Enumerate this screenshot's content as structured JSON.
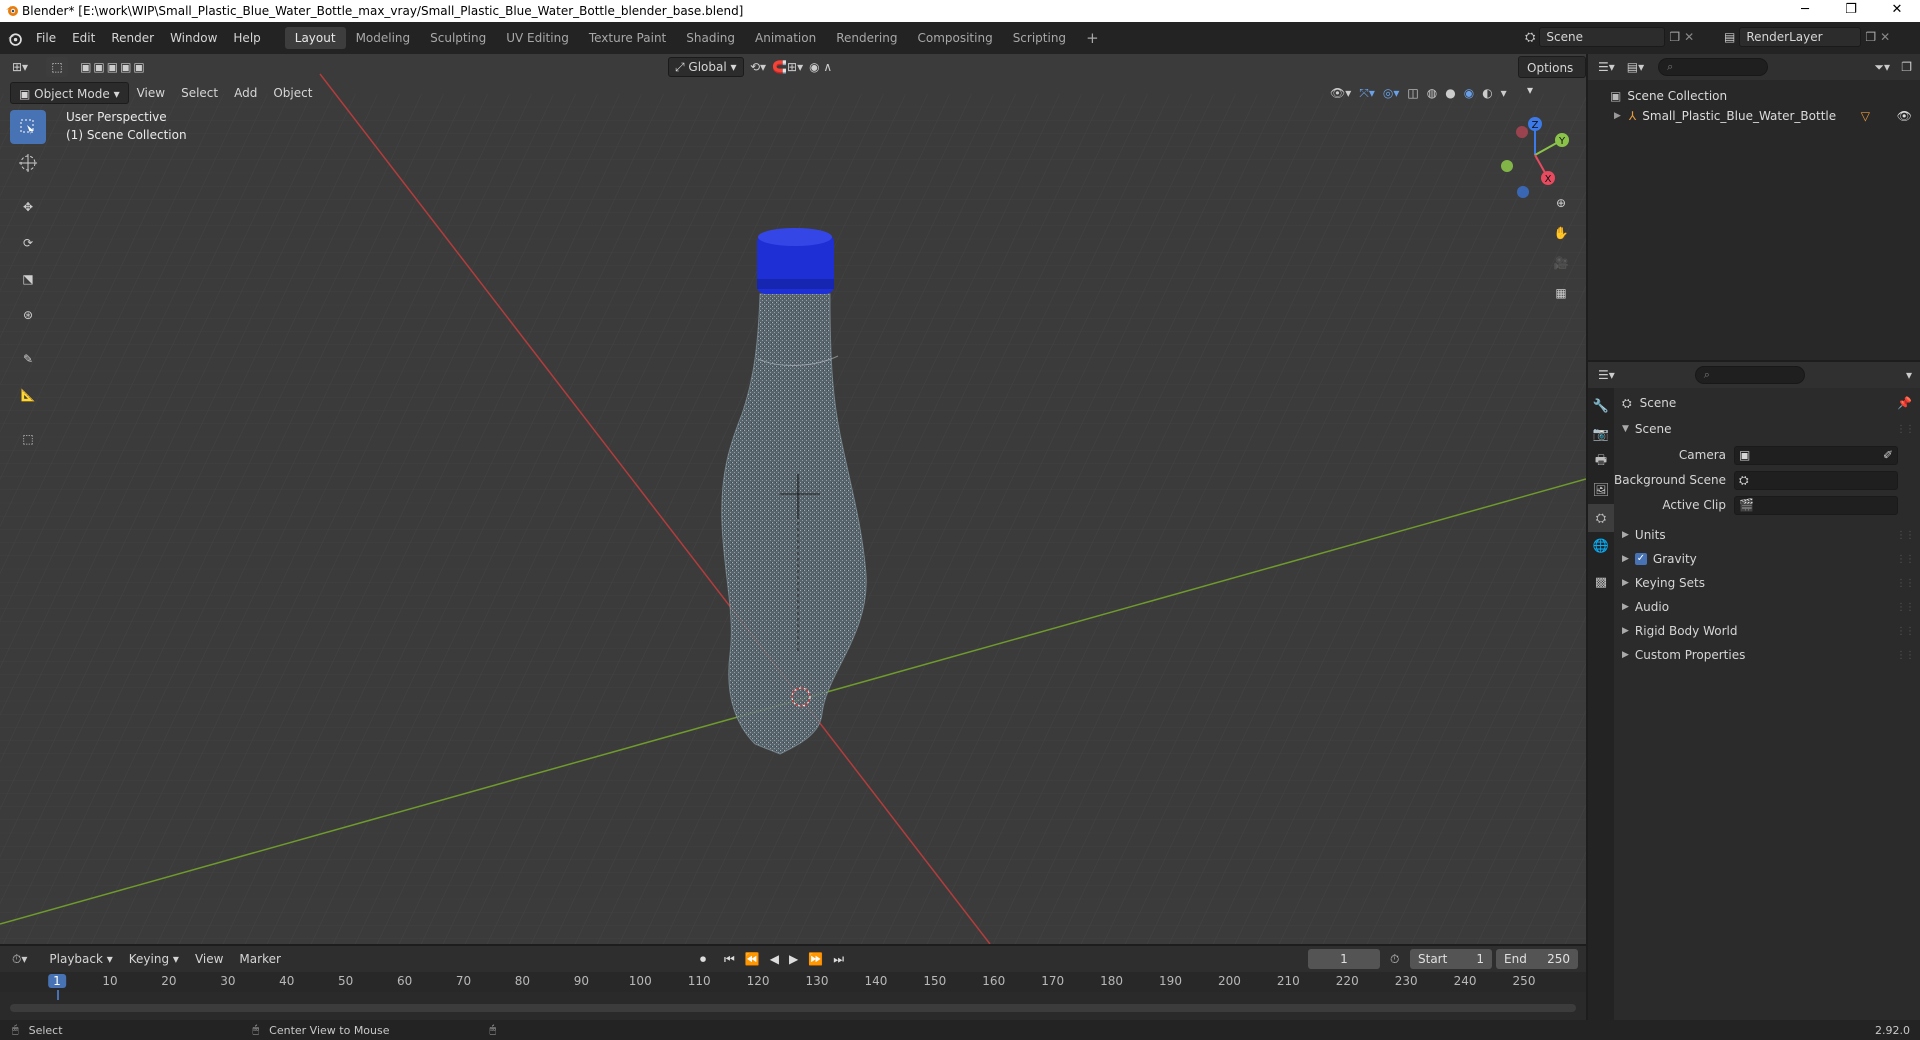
{
  "window": {
    "title": "Blender* [E:\\work\\WIP\\Small_Plastic_Blue_Water_Bottle_max_vray/Small_Plastic_Blue_Water_Bottle_blender_base.blend]",
    "minimize": "─",
    "maximize": "❐",
    "close": "✕"
  },
  "topbar": {
    "menus": [
      "File",
      "Edit",
      "Render",
      "Window",
      "Help"
    ],
    "workspaces": [
      "Layout",
      "Modeling",
      "Sculpting",
      "UV Editing",
      "Texture Paint",
      "Shading",
      "Animation",
      "Rendering",
      "Compositing",
      "Scripting"
    ],
    "active_workspace": "Layout",
    "add_workspace": "+",
    "scene_name": "Scene",
    "render_layer": "RenderLayer"
  },
  "viewport": {
    "mode": "Object Mode",
    "menus": [
      "View",
      "Select",
      "Add",
      "Object"
    ],
    "orientation": "Global",
    "options_label": "Options",
    "perspective_label": "User Perspective",
    "collection_label": "(1) Scene Collection",
    "gizmo": {
      "x": "X",
      "y": "Y",
      "z": "Z"
    },
    "colors": {
      "background": "#3a3a3a",
      "x_axis": "#c94040",
      "y_axis": "#7ea53a",
      "bottle_cap": "#1f2fd6"
    }
  },
  "tools": [
    "select-box",
    "cursor",
    "move",
    "rotate",
    "scale",
    "transform",
    "annotate",
    "measure",
    "add-cube"
  ],
  "outliner": {
    "root": "Scene Collection",
    "items": [
      {
        "name": "Small_Plastic_Blue_Water_Bottle"
      }
    ]
  },
  "properties": {
    "context_title": "Scene",
    "panel_title": "Scene",
    "fields": [
      {
        "label": "Camera"
      },
      {
        "label": "Background Scene"
      },
      {
        "label": "Active Clip"
      }
    ],
    "subpanels": [
      {
        "label": "Units",
        "checkbox": false
      },
      {
        "label": "Gravity",
        "checkbox": true
      },
      {
        "label": "Keying Sets",
        "checkbox": false
      },
      {
        "label": "Audio",
        "checkbox": false
      },
      {
        "label": "Rigid Body World",
        "checkbox": false
      },
      {
        "label": "Custom Properties",
        "checkbox": false
      }
    ]
  },
  "timeline": {
    "menus": [
      "Playback",
      "Keying",
      "View",
      "Marker"
    ],
    "current_frame": "1",
    "start_label": "Start",
    "start_value": "1",
    "end_label": "End",
    "end_value": "250",
    "ruler": [
      "1",
      "10",
      "20",
      "30",
      "40",
      "50",
      "60",
      "70",
      "80",
      "90",
      "100",
      "110",
      "120",
      "130",
      "140",
      "150",
      "160",
      "170",
      "180",
      "190",
      "200",
      "210",
      "220",
      "230",
      "240",
      "250"
    ]
  },
  "statusbar": {
    "left_hint": "Select",
    "middle_hint": "Center View to Mouse",
    "version": "2.92.0"
  }
}
